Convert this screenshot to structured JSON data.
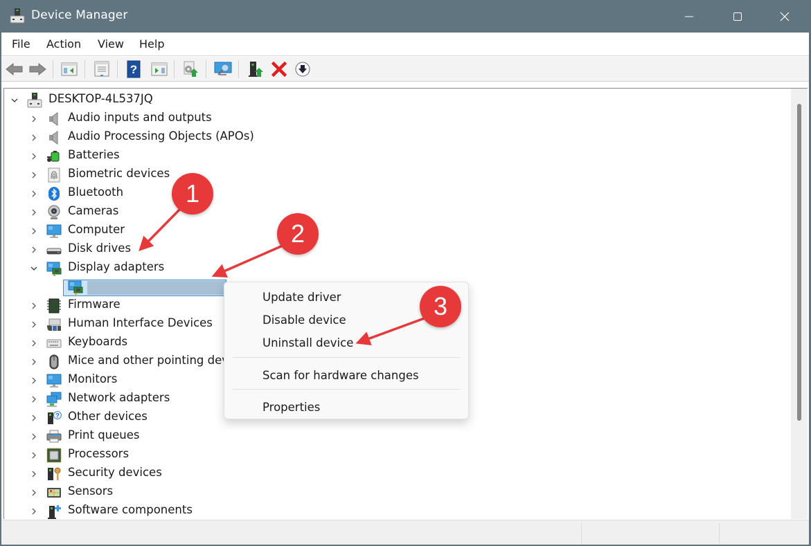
{
  "window": {
    "title": "Device Manager",
    "controls": {
      "minimize": "minimize",
      "maximize": "maximize",
      "close": "close"
    }
  },
  "menubar": {
    "items": [
      {
        "label": "File"
      },
      {
        "label": "Action"
      },
      {
        "label": "View"
      },
      {
        "label": "Help"
      }
    ]
  },
  "toolbar": {
    "buttons": [
      {
        "name": "back",
        "icon": "arrow-left-icon"
      },
      {
        "name": "forward",
        "icon": "arrow-right-icon"
      },
      {
        "name": "show-hide-console-tree",
        "icon": "console-tree-icon"
      },
      {
        "name": "properties",
        "icon": "properties-icon"
      },
      {
        "name": "help",
        "icon": "help-icon"
      },
      {
        "name": "show-hide-action-pane",
        "icon": "action-pane-icon"
      },
      {
        "name": "update-driver",
        "icon": "update-driver-icon"
      },
      {
        "name": "scan-hardware-changes",
        "icon": "scan-hardware-icon"
      },
      {
        "name": "enable-device",
        "icon": "enable-device-icon"
      },
      {
        "name": "uninstall-device",
        "icon": "uninstall-x-icon"
      },
      {
        "name": "disable-device",
        "icon": "disable-device-icon"
      }
    ]
  },
  "tree": {
    "root": {
      "label": "DESKTOP-4L537JQ",
      "expanded": true,
      "icon": "computer-tower-icon"
    },
    "categories": [
      {
        "label": "Audio inputs and outputs",
        "icon": "speaker-icon",
        "expanded": false
      },
      {
        "label": "Audio Processing Objects (APOs)",
        "icon": "speaker-icon",
        "expanded": false
      },
      {
        "label": "Batteries",
        "icon": "battery-icon",
        "expanded": false
      },
      {
        "label": "Biometric devices",
        "icon": "fingerprint-icon",
        "expanded": false
      },
      {
        "label": "Bluetooth",
        "icon": "bluetooth-icon",
        "expanded": false
      },
      {
        "label": "Cameras",
        "icon": "webcam-icon",
        "expanded": false
      },
      {
        "label": "Computer",
        "icon": "monitor-icon",
        "expanded": false
      },
      {
        "label": "Disk drives",
        "icon": "disk-drive-icon",
        "expanded": false
      },
      {
        "label": "Display adapters",
        "icon": "display-adapter-icon",
        "expanded": true,
        "children": [
          {
            "label": "",
            "redacted": true,
            "selected": true,
            "icon": "display-adapter-icon"
          }
        ]
      },
      {
        "label": "Firmware",
        "icon": "chip-icon",
        "expanded": false
      },
      {
        "label": "Human Interface Devices",
        "icon": "hid-icon",
        "expanded": false
      },
      {
        "label": "Keyboards",
        "icon": "keyboard-icon",
        "expanded": false
      },
      {
        "label": "Mice and other pointing dev",
        "icon": "mouse-icon",
        "expanded": false
      },
      {
        "label": "Monitors",
        "icon": "monitor-icon",
        "expanded": false
      },
      {
        "label": "Network adapters",
        "icon": "network-icon",
        "expanded": false
      },
      {
        "label": "Other devices",
        "icon": "unknown-device-icon",
        "expanded": false
      },
      {
        "label": "Print queues",
        "icon": "printer-icon",
        "expanded": false
      },
      {
        "label": "Processors",
        "icon": "processor-icon",
        "expanded": false
      },
      {
        "label": "Security devices",
        "icon": "security-key-icon",
        "expanded": false
      },
      {
        "label": "Sensors",
        "icon": "sensor-icon",
        "expanded": false
      },
      {
        "label": "Software components",
        "icon": "software-component-icon",
        "expanded": false
      }
    ]
  },
  "context_menu": {
    "items": [
      {
        "label": "Update driver"
      },
      {
        "label": "Disable device"
      },
      {
        "label": "Uninstall device"
      },
      {
        "separator": true
      },
      {
        "label": "Scan for hardware changes"
      },
      {
        "separator": true
      },
      {
        "label": "Properties"
      }
    ]
  },
  "annotations": {
    "color": "#e8393a",
    "steps": [
      {
        "number": "1",
        "target": "Display adapters"
      },
      {
        "number": "2",
        "target": "selected display adapter"
      },
      {
        "number": "3",
        "target": "Uninstall device"
      }
    ]
  },
  "colors": {
    "titlebar": "#617580",
    "selection_fill": "#cce4f7",
    "selection_border": "#3b8fd6",
    "annotation_red": "#e8393a"
  }
}
